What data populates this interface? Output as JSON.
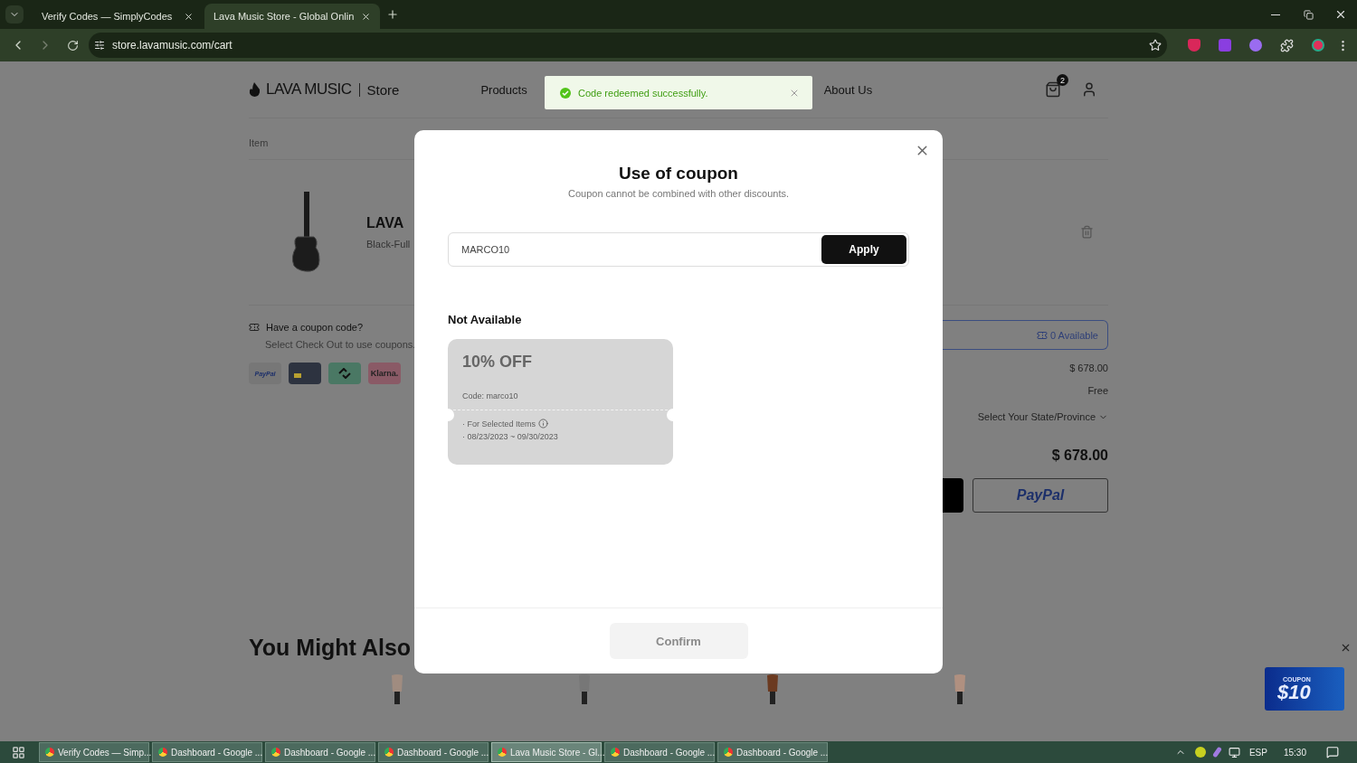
{
  "browser": {
    "tabs": [
      {
        "title": "Verify Codes — SimplyCodes",
        "selected": false
      },
      {
        "title": "Lava Music Store - Global Onlin",
        "selected": true
      }
    ],
    "url": "store.lavamusic.com/cart"
  },
  "header": {
    "brand": "LAVA MUSIC",
    "section": "Store",
    "nav": [
      "Products",
      "About Us"
    ],
    "cart_count": "2"
  },
  "toast": {
    "message": "Code redeemed successfully."
  },
  "cart": {
    "column_label": "Item",
    "product": {
      "name": "LAVA",
      "variant": "Black-Full"
    },
    "coupon_prompt": "Have a coupon code?",
    "coupon_hint": "Select Check Out to use coupons.",
    "payment_methods": [
      {
        "kind": "paypal",
        "label": "PayPal"
      },
      {
        "kind": "card"
      },
      {
        "kind": "link"
      },
      {
        "kind": "klarna",
        "label": "Klarna."
      }
    ]
  },
  "summary": {
    "coupons_available": "0 Available",
    "subtotal": "$ 678.00",
    "shipping": "Free",
    "tax": "Select Your State/Province",
    "total": "$ 678.00",
    "paypal": "PayPal"
  },
  "recommend": {
    "title": "You Might Also"
  },
  "promo": {
    "label": "COUPON",
    "amount": "$10"
  },
  "modal": {
    "title": "Use of coupon",
    "subtitle": "Coupon cannot be combined with other discounts.",
    "code": "MARCO10",
    "apply": "Apply",
    "section": "Not Available",
    "coupons": [
      {
        "discount": "10% OFF",
        "code": "Code: marco10",
        "scope": "· For Selected Items",
        "dates": "· 08/23/2023 ~ 09/30/2023",
        "available": false
      }
    ],
    "confirm": {
      "label": "Confirm",
      "disabled": true
    }
  },
  "taskbar": {
    "items": [
      {
        "title": "Verify Codes — Simp...",
        "selected": false
      },
      {
        "title": "Dashboard - Google ...",
        "selected": false
      },
      {
        "title": "Dashboard - Google ...",
        "selected": false
      },
      {
        "title": "Dashboard - Google ...",
        "selected": false
      },
      {
        "title": "Lava Music Store - Gl...",
        "selected": true
      },
      {
        "title": "Dashboard - Google ...",
        "selected": false
      },
      {
        "title": "Dashboard - Google ...",
        "selected": false
      }
    ],
    "language": "ESP",
    "time": "15:30"
  }
}
